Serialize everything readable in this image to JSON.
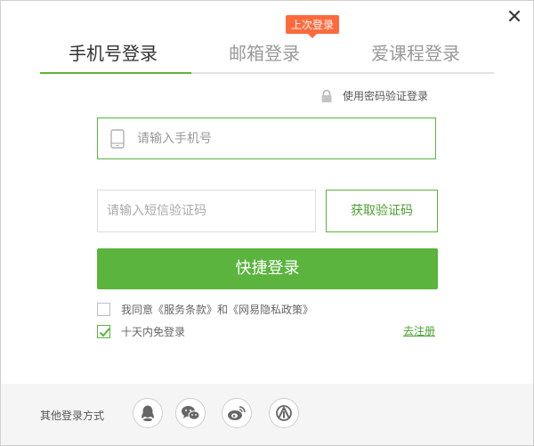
{
  "tabs": [
    {
      "label": "手机号登录",
      "active": true
    },
    {
      "label": "邮箱登录",
      "active": false
    },
    {
      "label": "爱课程登录",
      "active": false
    }
  ],
  "badge": "上次登录",
  "password_login_link": "使用密码验证登录",
  "phone_input": {
    "value": "",
    "placeholder": "请输入手机号"
  },
  "sms_input": {
    "value": "",
    "placeholder": "请输入短信验证码"
  },
  "get_code_label": "获取验证码",
  "login_button_label": "快捷登录",
  "agreement_text": "我同意《服务条款》和《网易隐私政策》",
  "agreement_checked": false,
  "remember_text": "十天内免登录",
  "remember_checked": true,
  "register_link": "去注册",
  "footer": {
    "label": "其他登录方式",
    "icons": [
      "qq-icon",
      "wechat-icon",
      "weibo-icon",
      "icourse-icon"
    ]
  },
  "colors": {
    "accent": "#5ab43d",
    "badge": "#ff6a3c",
    "footer_bg": "#f5f5f5"
  }
}
